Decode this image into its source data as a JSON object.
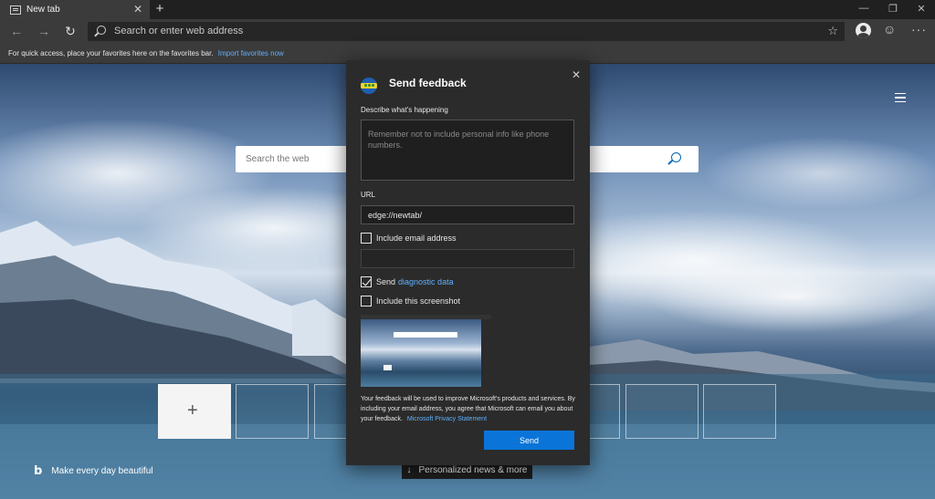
{
  "browser": {
    "tab_title": "New tab",
    "tab_close": "✕",
    "new_tab": "+",
    "window_controls": [
      "—",
      "❐",
      "✕"
    ],
    "nav": {
      "back": "←",
      "forward": "→",
      "refresh": "↻"
    },
    "address_placeholder": "Search or enter web address",
    "star": "☆",
    "emoji": "☺",
    "more": "···"
  },
  "favorites_bar": {
    "text": "For quick access, place your favorites here on the favorites bar.",
    "link": "Import favorites now"
  },
  "newtab": {
    "search_placeholder": "Search the web",
    "add_tile": "+",
    "bing_logo": "b",
    "brand_text": "Make every day beautiful",
    "news_arrow": "↓",
    "news_button": "Personalized news & more"
  },
  "feedback": {
    "title": "Send feedback",
    "close": "✕",
    "describe_label": "Describe what's happening",
    "describe_placeholder": "Remember not to include personal info like phone numbers.",
    "url_label": "URL",
    "url_value": "edge://newtab/",
    "include_email_label": "Include email address",
    "include_email_checked": false,
    "send_label": "Send",
    "diagnostic_link": "diagnostic data",
    "send_diagnostic_checked": true,
    "screenshot_label": "Include this screenshot",
    "screenshot_checked": false,
    "disclaimer": "Your feedback will be used to improve Microsoft's products and services. By including your email address, you agree that Microsoft can email you about your feedback.",
    "privacy_link": "Microsoft Privacy Statement",
    "send_button": "Send"
  },
  "colors": {
    "accent": "#0a74d8",
    "link": "#5fb1ff",
    "dialog_bg": "#2b2b2b",
    "toolbar_bg": "#3b3b3b"
  }
}
